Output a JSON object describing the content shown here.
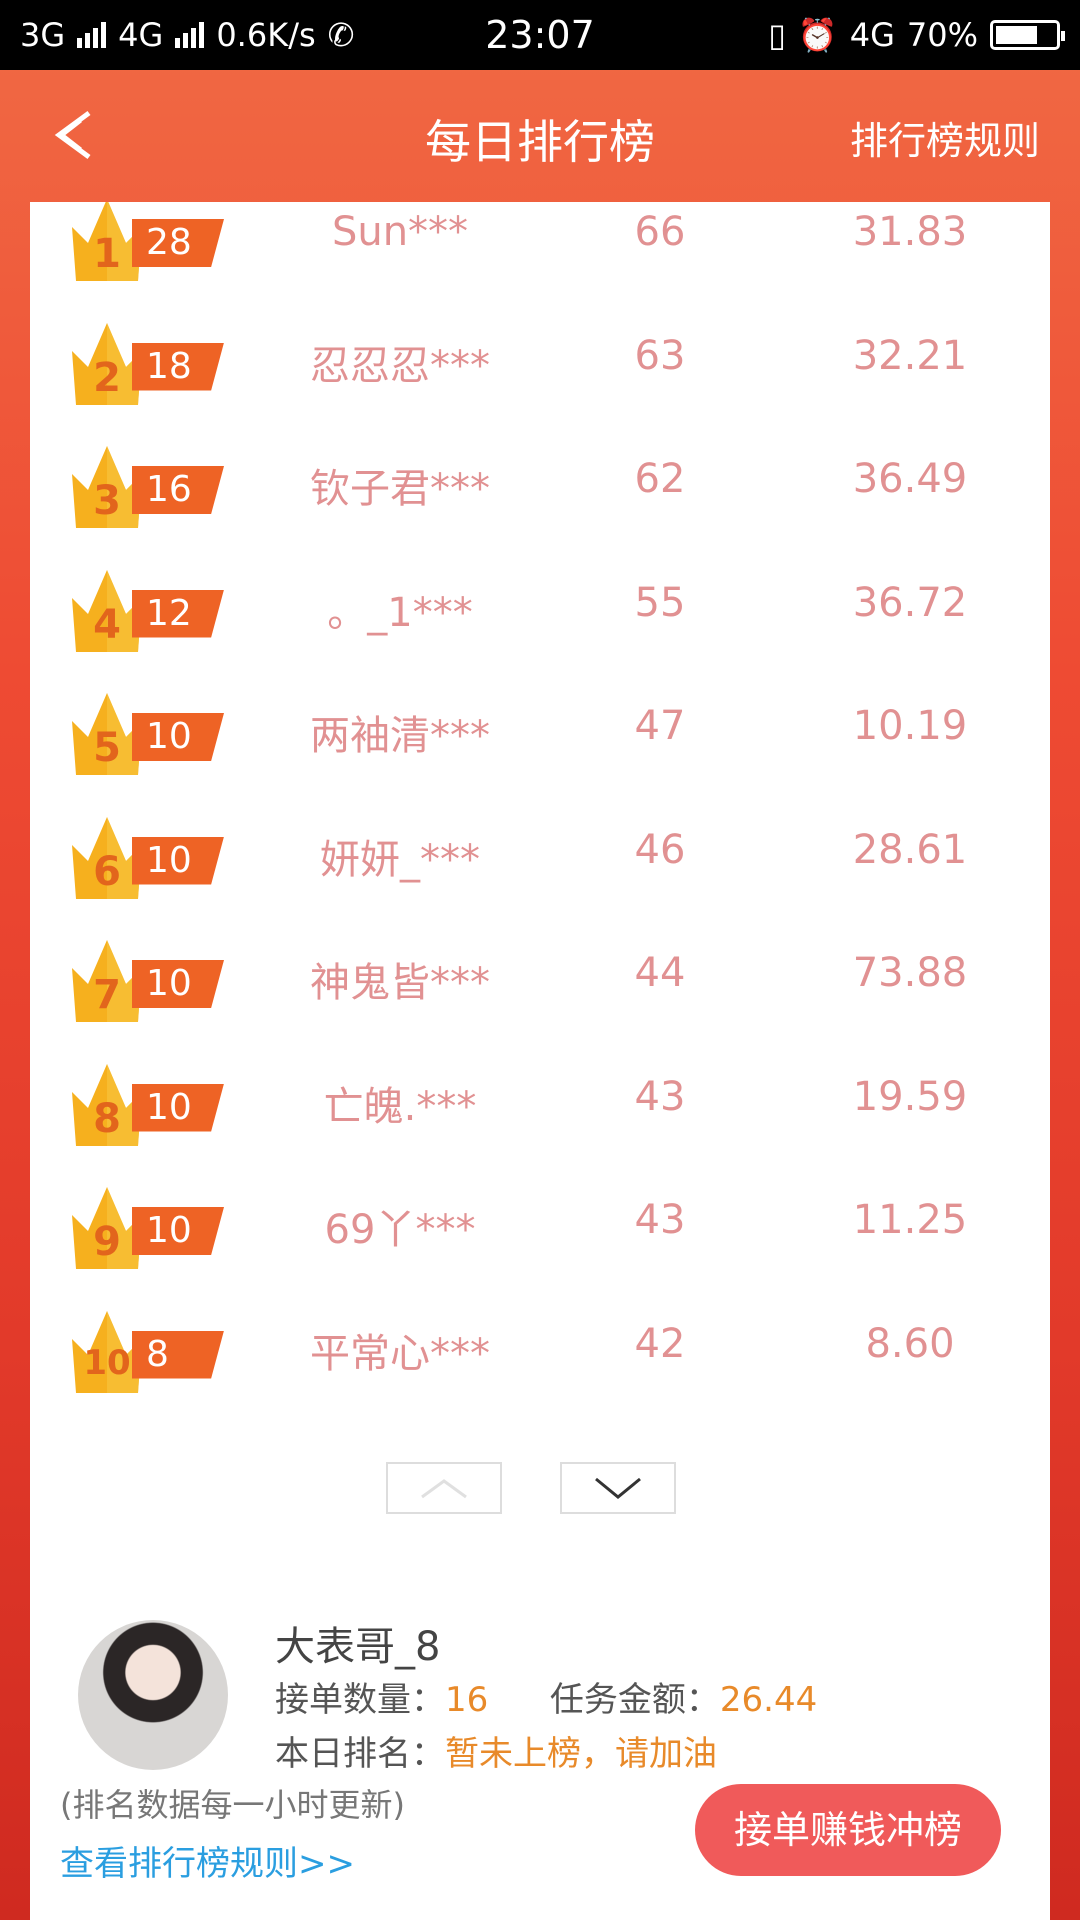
{
  "status_bar": {
    "network_1": "3G",
    "network_2": "4G",
    "speed": "0.6K/s",
    "time": "23:07",
    "network_3": "4G",
    "battery": "70%",
    "battery_level": 0.7
  },
  "header": {
    "title": "每日排行榜",
    "rules": "排行榜规则"
  },
  "ranking": [
    {
      "rank": "1",
      "badge": "28",
      "name": "Sun***",
      "count": "66",
      "amount": "31.83"
    },
    {
      "rank": "2",
      "badge": "18",
      "name": "忍忍忍***",
      "count": "63",
      "amount": "32.21"
    },
    {
      "rank": "3",
      "badge": "16",
      "name": "钦子君***",
      "count": "62",
      "amount": "36.49"
    },
    {
      "rank": "4",
      "badge": "12",
      "name": "。_1***",
      "count": "55",
      "amount": "36.72"
    },
    {
      "rank": "5",
      "badge": "10",
      "name": "两袖清***",
      "count": "47",
      "amount": "10.19"
    },
    {
      "rank": "6",
      "badge": "10",
      "name": "妍妍_***",
      "count": "46",
      "amount": "28.61"
    },
    {
      "rank": "7",
      "badge": "10",
      "name": "神鬼皆***",
      "count": "44",
      "amount": "73.88"
    },
    {
      "rank": "8",
      "badge": "10",
      "name": "亡魄.***",
      "count": "43",
      "amount": "19.59"
    },
    {
      "rank": "9",
      "badge": "10",
      "name": "69丫***",
      "count": "43",
      "amount": "11.25"
    },
    {
      "rank": "10",
      "badge": "8",
      "name": "平常心***",
      "count": "42",
      "amount": "8.60"
    }
  ],
  "user": {
    "name": "大表哥_8",
    "orders_label": "接单数量：",
    "orders_value": "16",
    "amount_label": "任务金额：",
    "amount_value": "26.44",
    "today_rank_label": "本日排名：",
    "today_rank_value": "暂未上榜，请加油"
  },
  "footer": {
    "note": "(排名数据每一小时更新)",
    "rules_link": "查看排行榜规则>>",
    "cta": "接单赚钱冲榜"
  }
}
